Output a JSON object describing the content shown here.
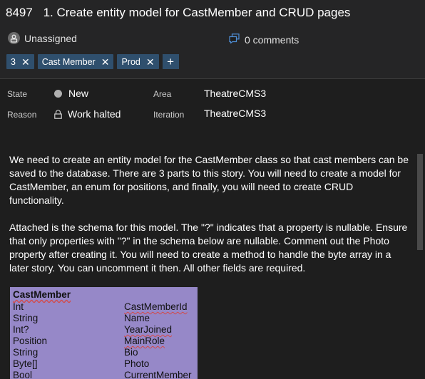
{
  "work_item": {
    "id": "8497",
    "title": "1. Create entity model for CastMember and CRUD pages"
  },
  "assignee": {
    "label": "Unassigned",
    "icon": "user-icon"
  },
  "comments": {
    "label": "0 comments",
    "icon": "comment-icon"
  },
  "tags": [
    "3",
    "Cast Member",
    "Prod"
  ],
  "tag_add_symbol": "+",
  "fields": {
    "state_label": "State",
    "state_value": "New",
    "reason_label": "Reason",
    "reason_value": "Work halted",
    "area_label": "Area",
    "area_value": "TheatreCMS3",
    "iteration_label": "Iteration",
    "iteration_value": "TheatreCMS3"
  },
  "description": {
    "para1": "We need to create an entity model for the CastMember class so that cast members can be saved to the database. There are 3 parts to this story. You will need to create a model for CastMember, an enum for positions, and finally, you will need to create CRUD functionality.",
    "para2": "Attached is the schema for this model. The \"?\" indicates that a property is nullable. Ensure that only properties with \"?\" in the schema below are nullable. Comment out the Photo property after creating it. You will need to create a method to handle the byte array in a later story. You can uncomment it then. All other fields are required."
  },
  "schema": {
    "title": "CastMember",
    "rows": [
      {
        "type": "Int",
        "name": "CastMemberId"
      },
      {
        "type": "String",
        "name": "Name"
      },
      {
        "type": "Int?",
        "name": "YearJoined"
      },
      {
        "type": "Position",
        "name": "MainRole"
      },
      {
        "type": "String",
        "name": "Bio"
      },
      {
        "type": "Byte[]",
        "name": "Photo"
      },
      {
        "type": "Bool",
        "name": "CurrentMember"
      }
    ]
  },
  "colors": {
    "background": "#1e1e1e",
    "tag_background": "#2f4f6d",
    "schema_background": "#9688c8",
    "spellcheck_underline": "#d24a4a"
  }
}
